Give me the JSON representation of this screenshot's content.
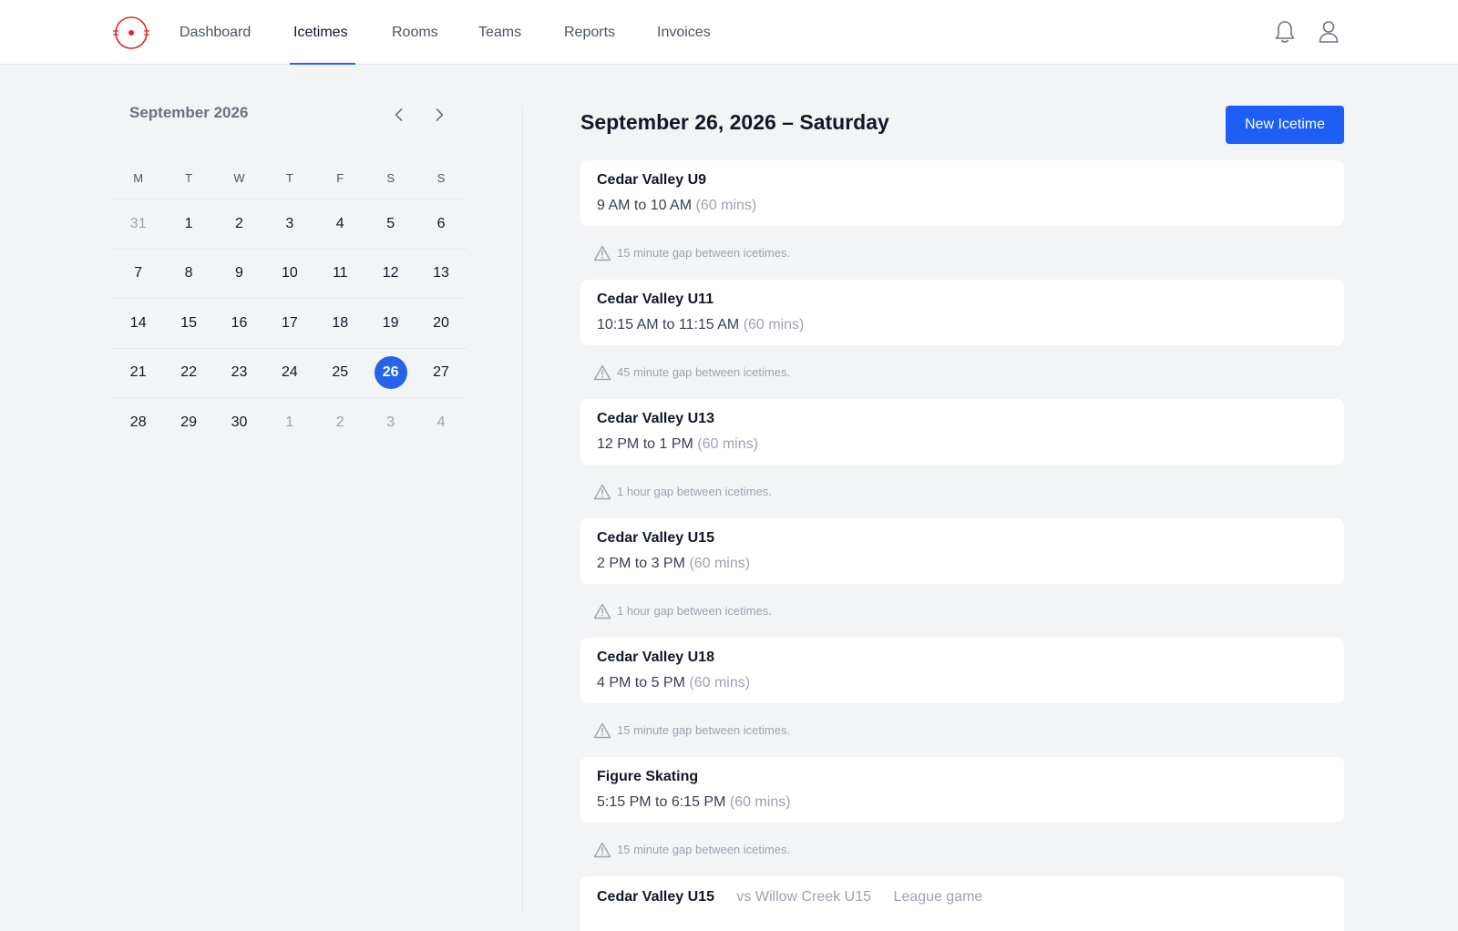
{
  "nav": {
    "items": [
      {
        "label": "Dashboard"
      },
      {
        "label": "Icetimes"
      },
      {
        "label": "Rooms"
      },
      {
        "label": "Teams"
      },
      {
        "label": "Reports"
      },
      {
        "label": "Invoices"
      }
    ],
    "active": "Icetimes",
    "icons": [
      "bell-icon",
      "user-icon"
    ]
  },
  "calendar": {
    "title": "September 2026",
    "weekdays": [
      "M",
      "T",
      "W",
      "T",
      "F",
      "S",
      "S"
    ],
    "weeks": [
      [
        "31",
        "1",
        "2",
        "3",
        "4",
        "5",
        "6"
      ],
      [
        "7",
        "8",
        "9",
        "10",
        "11",
        "12",
        "13"
      ],
      [
        "14",
        "15",
        "16",
        "17",
        "18",
        "19",
        "20"
      ],
      [
        "21",
        "22",
        "23",
        "24",
        "25",
        "26",
        "27"
      ],
      [
        "28",
        "29",
        "30",
        "1",
        "2",
        "3",
        "4"
      ]
    ],
    "selected": "26"
  },
  "day": {
    "title": "September 26, 2026 – Saturday",
    "new_button": "New Icetime",
    "icetimes": [
      {
        "title": "Cedar Valley U9",
        "time": "9 AM to 10 AM",
        "duration": "(60 mins)",
        "gap": "15 minute gap between icetimes."
      },
      {
        "title": "Cedar Valley U11",
        "time": "10:15 AM to 11:15 AM",
        "duration": "(60 mins)",
        "gap": "45 minute gap between icetimes."
      },
      {
        "title": "Cedar Valley U13",
        "time": "12 PM to 1 PM",
        "duration": "(60 mins)",
        "gap": "1 hour gap between icetimes."
      },
      {
        "title": "Cedar Valley U15",
        "time": "2 PM to 3 PM",
        "duration": "(60 mins)",
        "gap": "1 hour gap between icetimes."
      },
      {
        "title": "Cedar Valley U18",
        "time": "4 PM to 5 PM",
        "duration": "(60 mins)",
        "gap": "15 minute gap between icetimes."
      },
      {
        "title": "Figure Skating",
        "time": "5:15 PM to 6:15 PM",
        "duration": "(60 mins)",
        "gap": "15 minute gap between icetimes."
      }
    ],
    "last": {
      "title": "Cedar Valley U15",
      "opponent": "vs Willow Creek U15",
      "type": "League game"
    }
  },
  "colors": {
    "accent": "#2563eb",
    "logo": "#dc2626",
    "background": "#f3f4f6"
  }
}
